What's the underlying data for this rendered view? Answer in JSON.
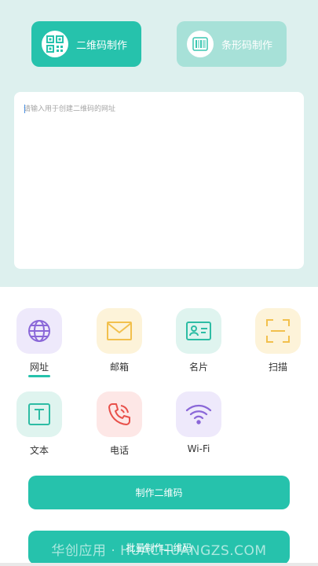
{
  "mode_tabs": [
    {
      "label": "二维码制作",
      "icon": "qr-code-icon",
      "active": true
    },
    {
      "label": "条形码制作",
      "icon": "barcode-icon",
      "active": false
    }
  ],
  "input": {
    "placeholder": "请输入用于创建二维码的网址",
    "value": ""
  },
  "types": [
    {
      "label": "网址",
      "icon": "globe-icon",
      "selected": true
    },
    {
      "label": "邮箱",
      "icon": "envelope-icon",
      "selected": false
    },
    {
      "label": "名片",
      "icon": "contact-card-icon",
      "selected": false
    },
    {
      "label": "扫描",
      "icon": "scan-icon",
      "selected": false
    },
    {
      "label": "文本",
      "icon": "text-icon",
      "selected": false
    },
    {
      "label": "电话",
      "icon": "phone-icon",
      "selected": false
    },
    {
      "label": "Wi-Fi",
      "icon": "wifi-icon",
      "selected": false
    }
  ],
  "actions": {
    "make_label": "制作二维码",
    "batch_label": "批量制作二维码"
  },
  "watermark": "华创应用 · HUACHUANGZS.COM",
  "colors": {
    "accent": "#26c2ac",
    "accent_light": "#a7e1d8",
    "top_background": "#ddf0ee"
  }
}
